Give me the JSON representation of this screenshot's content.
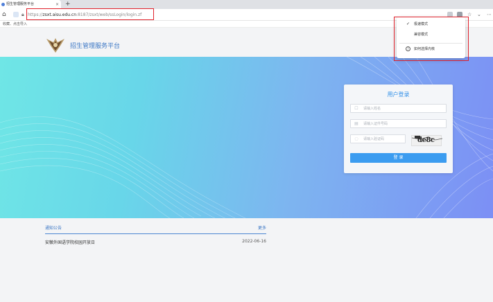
{
  "browser": {
    "tab_title": "招生管理服务平台",
    "tab_close": "×",
    "new_tab": "+",
    "url_protocol": "https://",
    "url_host": "zsxt.aisu.edu.cn",
    "url_path": ":8187/zsxt/web/ssLogin/login.zf",
    "bookmarks_text": "收藏、点击导入",
    "right_icon_a": "☆",
    "right_icon_b": "⋯",
    "right_icon_c": "⌄"
  },
  "header": {
    "site_title": "招生管理服务平台"
  },
  "login": {
    "title": "用户登录",
    "username_placeholder": "请输入姓名",
    "id_placeholder": "请输入证件号码",
    "captcha_placeholder": "请输入验证码",
    "captcha_code": "de8c",
    "submit_label": "登  录"
  },
  "notices": {
    "title": "通知公告",
    "more_label": "更多",
    "items": [
      {
        "title": "安徽外国语学院校园开放日",
        "date": "2022-06-16"
      }
    ]
  },
  "context_menu": {
    "items": [
      {
        "label": "极速模式",
        "checked": true
      },
      {
        "label": "兼容模式",
        "checked": false
      },
      {
        "label": "如何选择内核",
        "checked": false
      }
    ]
  },
  "colors": {
    "accent": "#3c77c5",
    "button": "#3b9cf0",
    "highlight_box": "#e0202a"
  }
}
